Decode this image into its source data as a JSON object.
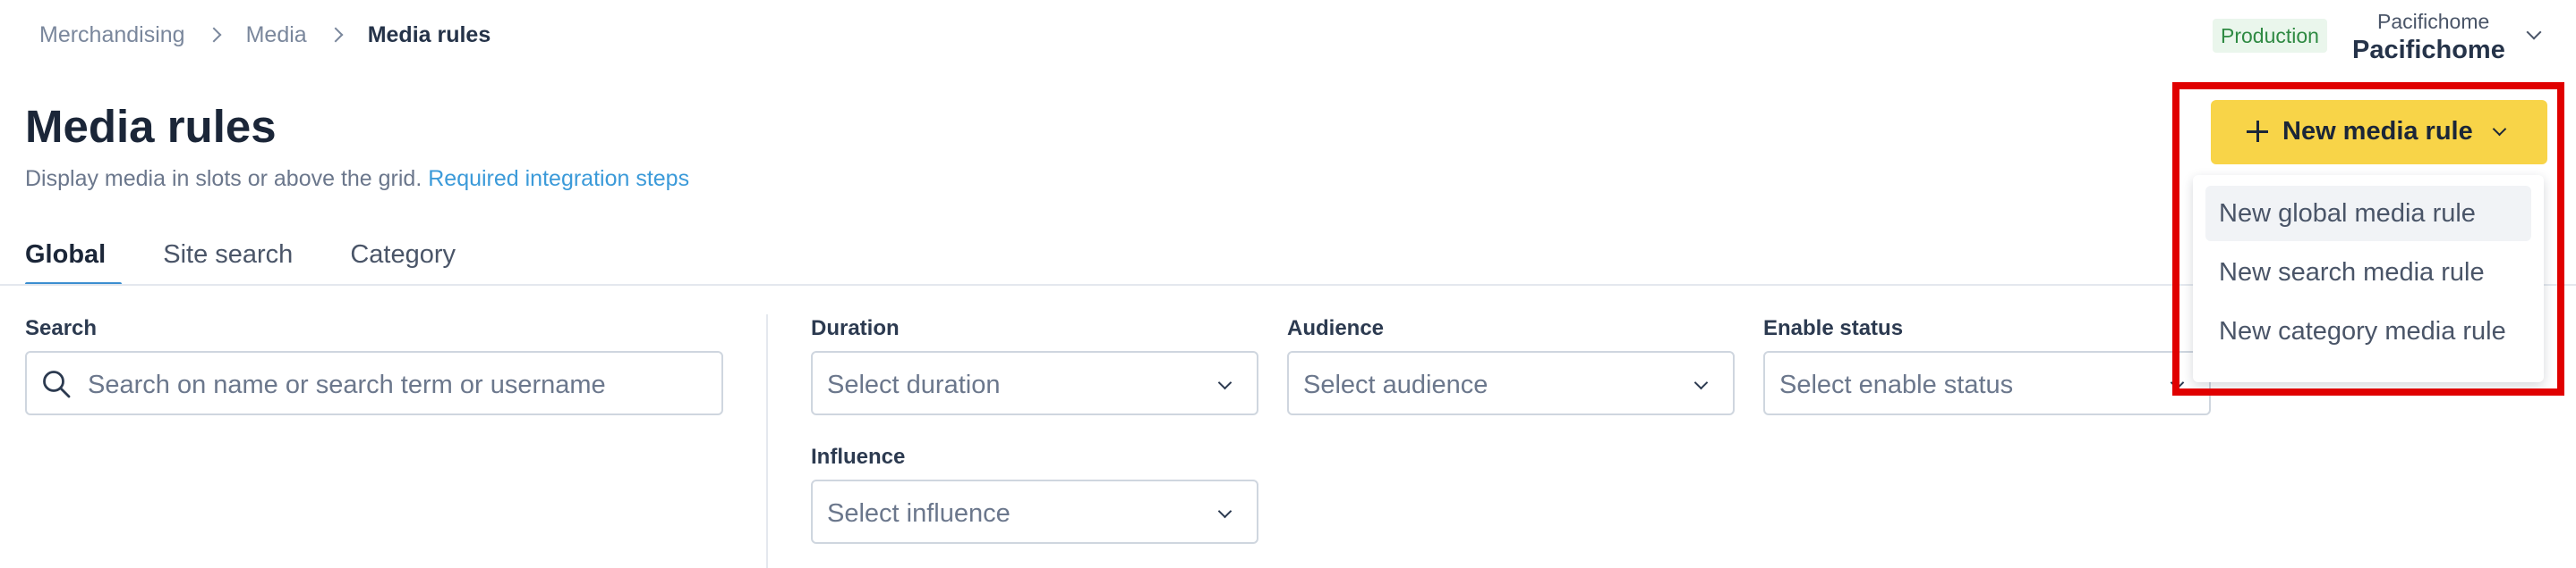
{
  "breadcrumb": {
    "items": [
      "Merchandising",
      "Media",
      "Media rules"
    ]
  },
  "account": {
    "environment": "Production",
    "org_small": "Pacifichome",
    "org_name": "Pacifichome"
  },
  "header": {
    "title": "Media rules",
    "description": "Display media in slots or above the grid.",
    "link_text": "Required integration steps"
  },
  "tabs": [
    {
      "label": "Global",
      "active": true
    },
    {
      "label": "Site search",
      "active": false
    },
    {
      "label": "Category",
      "active": false
    }
  ],
  "filters": {
    "search": {
      "label": "Search",
      "placeholder": "Search on name or search term or username"
    },
    "duration": {
      "label": "Duration",
      "placeholder": "Select duration"
    },
    "audience": {
      "label": "Audience",
      "placeholder": "Select audience"
    },
    "enable_status": {
      "label": "Enable status",
      "placeholder": "Select enable status"
    },
    "influence": {
      "label": "Influence",
      "placeholder": "Select influence"
    }
  },
  "new_rule": {
    "button_label": "New media rule",
    "menu": [
      "New global media rule",
      "New search media rule",
      "New category media rule"
    ]
  },
  "colors": {
    "accent_yellow": "#f8d448",
    "link_blue": "#3b9ad9",
    "production_green": "#2f8a43",
    "highlight_red": "#e00000"
  }
}
